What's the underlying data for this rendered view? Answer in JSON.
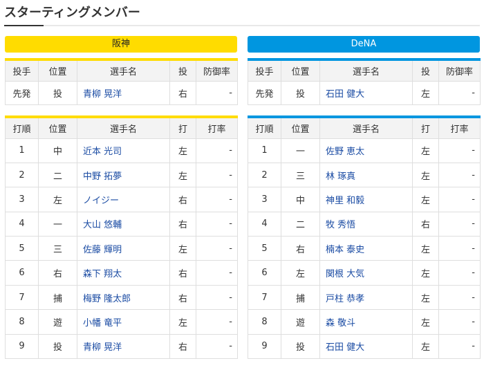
{
  "title": "スターティングメンバー",
  "teams": {
    "home": {
      "name": "阪神",
      "color": "#ffdc00"
    },
    "away": {
      "name": "DeNA",
      "color": "#0096e0"
    }
  },
  "pitcher_headers": [
    "投手",
    "位置",
    "選手名",
    "投",
    "防御率"
  ],
  "batter_headers": [
    "打順",
    "位置",
    "選手名",
    "打",
    "打率"
  ],
  "home_pitcher": {
    "role": "先発",
    "pos": "投",
    "name": "青柳 晃洋",
    "throws": "右",
    "era": "-"
  },
  "away_pitcher": {
    "role": "先発",
    "pos": "投",
    "name": "石田 健大",
    "throws": "左",
    "era": "-"
  },
  "home_batters": [
    {
      "order": "1",
      "pos": "中",
      "name": "近本 光司",
      "bats": "左",
      "avg": "-"
    },
    {
      "order": "2",
      "pos": "二",
      "name": "中野 拓夢",
      "bats": "左",
      "avg": "-"
    },
    {
      "order": "3",
      "pos": "左",
      "name": "ノイジー",
      "bats": "右",
      "avg": "-"
    },
    {
      "order": "4",
      "pos": "一",
      "name": "大山 悠輔",
      "bats": "右",
      "avg": "-"
    },
    {
      "order": "5",
      "pos": "三",
      "name": "佐藤 輝明",
      "bats": "左",
      "avg": "-"
    },
    {
      "order": "6",
      "pos": "右",
      "name": "森下 翔太",
      "bats": "右",
      "avg": "-"
    },
    {
      "order": "7",
      "pos": "捕",
      "name": "梅野 隆太郎",
      "bats": "右",
      "avg": "-"
    },
    {
      "order": "8",
      "pos": "遊",
      "name": "小幡 竜平",
      "bats": "左",
      "avg": "-"
    },
    {
      "order": "9",
      "pos": "投",
      "name": "青柳 晃洋",
      "bats": "右",
      "avg": "-"
    }
  ],
  "away_batters": [
    {
      "order": "1",
      "pos": "一",
      "name": "佐野 恵太",
      "bats": "左",
      "avg": "-"
    },
    {
      "order": "2",
      "pos": "三",
      "name": "林 琢真",
      "bats": "左",
      "avg": "-"
    },
    {
      "order": "3",
      "pos": "中",
      "name": "神里 和毅",
      "bats": "左",
      "avg": "-"
    },
    {
      "order": "4",
      "pos": "二",
      "name": "牧 秀悟",
      "bats": "右",
      "avg": "-"
    },
    {
      "order": "5",
      "pos": "右",
      "name": "楠本 泰史",
      "bats": "左",
      "avg": "-"
    },
    {
      "order": "6",
      "pos": "左",
      "name": "関根 大気",
      "bats": "左",
      "avg": "-"
    },
    {
      "order": "7",
      "pos": "捕",
      "name": "戸柱 恭孝",
      "bats": "左",
      "avg": "-"
    },
    {
      "order": "8",
      "pos": "遊",
      "name": "森 敬斗",
      "bats": "左",
      "avg": "-"
    },
    {
      "order": "9",
      "pos": "投",
      "name": "石田 健大",
      "bats": "左",
      "avg": "-"
    }
  ]
}
